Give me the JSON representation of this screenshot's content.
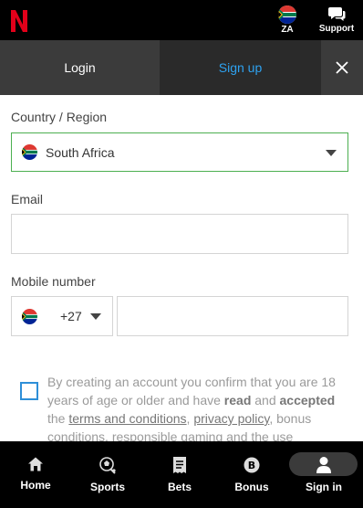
{
  "header": {
    "logo_letter": "N",
    "brand_color": "#e2001a",
    "region_code": "ZA",
    "support_label": "Support"
  },
  "tabs": {
    "login_label": "Login",
    "signup_label": "Sign up",
    "close_icon": "close-icon"
  },
  "form": {
    "country_label": "Country / Region",
    "country_value": "South Africa",
    "email_label": "Email",
    "email_value": "",
    "mobile_label": "Mobile number",
    "dial_code": "+27",
    "mobile_value": ""
  },
  "consent": {
    "text_1": "By creating an account you confirm that you are 18 years of age or older and have ",
    "read": "read",
    "text_2": " and ",
    "accepted": "accepted",
    "text_3": " the ",
    "terms_link": "terms and conditions",
    "comma_1": ", ",
    "privacy_link": "privacy policy",
    "comma_2": ",",
    "text_4": " bonus conditions, responsible gaming and the use"
  },
  "bottom_nav": {
    "items": [
      {
        "label": "Home",
        "icon": "home-icon"
      },
      {
        "label": "Sports",
        "icon": "sports-icon"
      },
      {
        "label": "Bets",
        "icon": "bets-icon"
      },
      {
        "label": "Bonus",
        "icon": "bonus-icon"
      },
      {
        "label": "Sign in",
        "icon": "user-icon"
      }
    ]
  },
  "colors": {
    "accent_blue": "#2ea2f0",
    "active_border_green": "#4caf50",
    "checkbox_blue": "#2e8fd8"
  }
}
